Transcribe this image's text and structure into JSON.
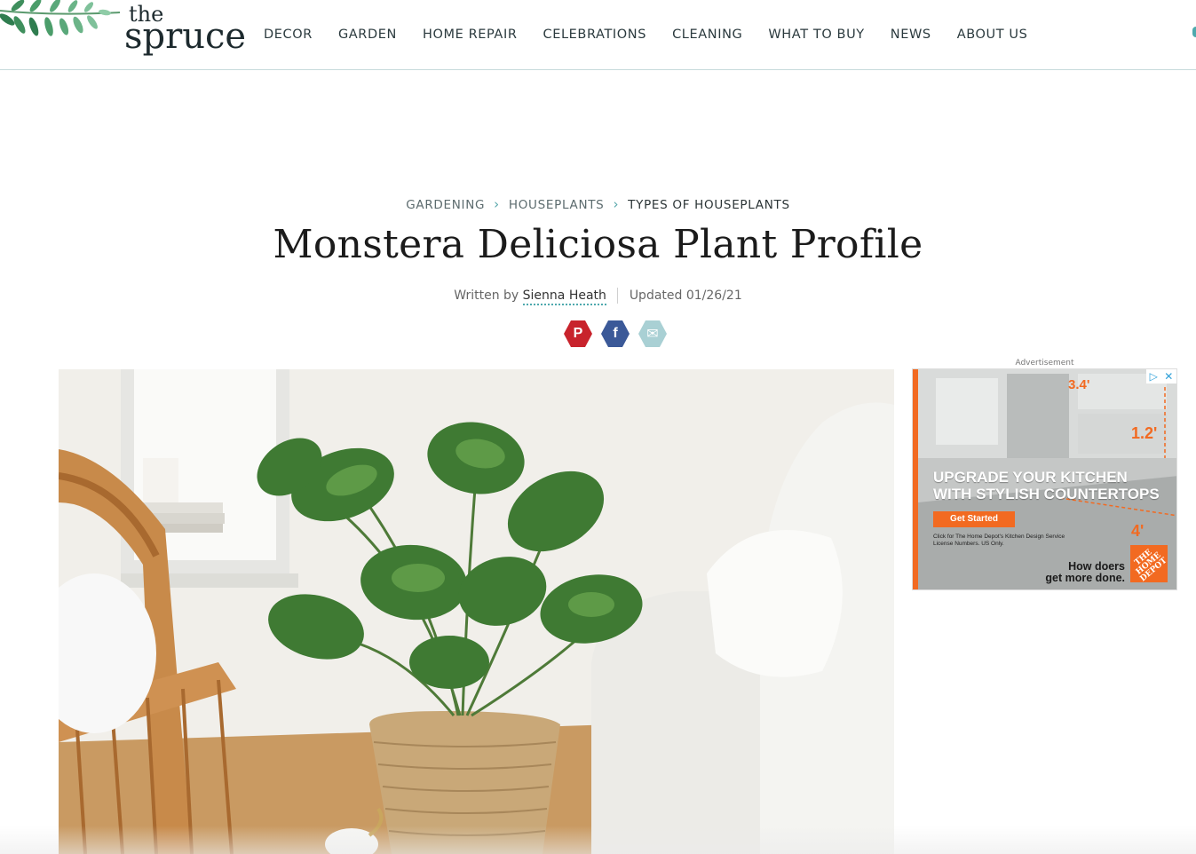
{
  "brand": {
    "the": "the",
    "spruce": "spruce"
  },
  "nav": [
    "DECOR",
    "GARDEN",
    "HOME REPAIR",
    "CELEBRATIONS",
    "CLEANING",
    "WHAT TO BUY",
    "NEWS",
    "ABOUT US"
  ],
  "breadcrumb": {
    "items": [
      "GARDENING",
      "HOUSEPLANTS"
    ],
    "current": "TYPES OF HOUSEPLANTS"
  },
  "article": {
    "title": "Monstera Deliciosa Plant Profile",
    "written_by": "Written by",
    "author": "Sienna Heath",
    "updated": "Updated 01/26/21"
  },
  "social": {
    "pinterest": "P",
    "facebook": "f",
    "email": "✉"
  },
  "ad": {
    "label": "Advertisement",
    "headline_1": "UPGRADE YOUR KITCHEN",
    "headline_2": "WITH STYLISH COUNTERTOPS",
    "cta": "Get Started",
    "fine_print": "Click for The Home Depot's Kitchen Design Service License Numbers. US Only.",
    "tagline_1": "How doers",
    "tagline_2": "get more done.",
    "dim_1": "3.4'",
    "dim_2": "1.2'",
    "dim_3": "4'",
    "logo_text": "THE HOME DEPOT"
  },
  "colors": {
    "accent": "#4ea9ad",
    "pinterest": "#c8232c",
    "facebook": "#3b5998",
    "email": "#a9d0d4",
    "ad_orange": "#f26a21"
  }
}
